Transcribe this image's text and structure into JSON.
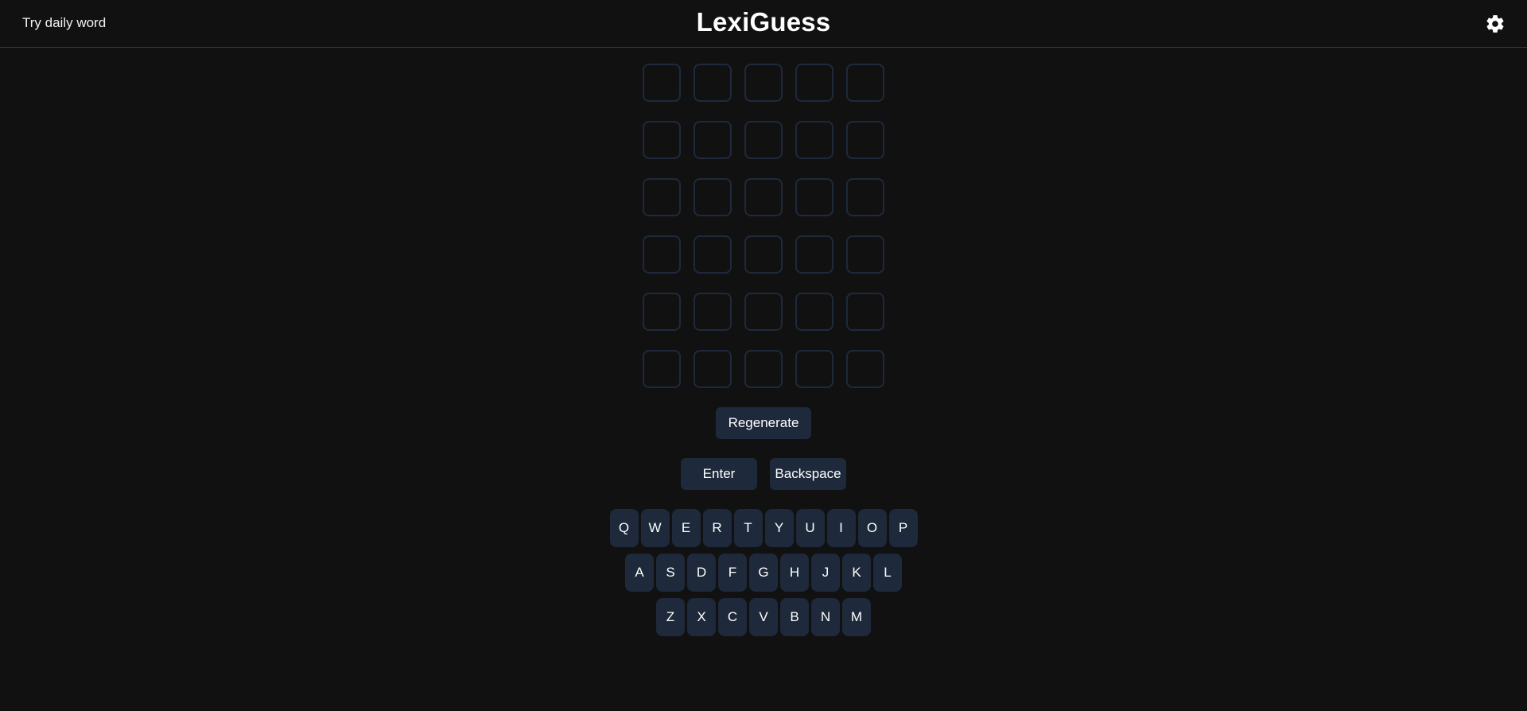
{
  "header": {
    "daily_link": "Try daily word",
    "title": "LexiGuess",
    "settings_icon": "gear-icon"
  },
  "board": {
    "rows": 6,
    "columns": 5,
    "tiles": [
      [
        "",
        "",
        "",
        "",
        ""
      ],
      [
        "",
        "",
        "",
        "",
        ""
      ],
      [
        "",
        "",
        "",
        "",
        ""
      ],
      [
        "",
        "",
        "",
        "",
        ""
      ],
      [
        "",
        "",
        "",
        "",
        ""
      ],
      [
        "",
        "",
        "",
        "",
        ""
      ]
    ]
  },
  "controls": {
    "regenerate_label": "Regenerate",
    "enter_label": "Enter",
    "backspace_label": "Backspace"
  },
  "keyboard": {
    "rows": [
      [
        "Q",
        "W",
        "E",
        "R",
        "T",
        "Y",
        "U",
        "I",
        "O",
        "P"
      ],
      [
        "A",
        "S",
        "D",
        "F",
        "G",
        "H",
        "J",
        "K",
        "L"
      ],
      [
        "Z",
        "X",
        "C",
        "V",
        "B",
        "N",
        "M"
      ]
    ]
  },
  "colors": {
    "background": "#111111",
    "key_background": "#1e293b",
    "tile_border": "#1e2a3b",
    "header_divider": "#2d3a4e",
    "text": "#ffffff"
  }
}
